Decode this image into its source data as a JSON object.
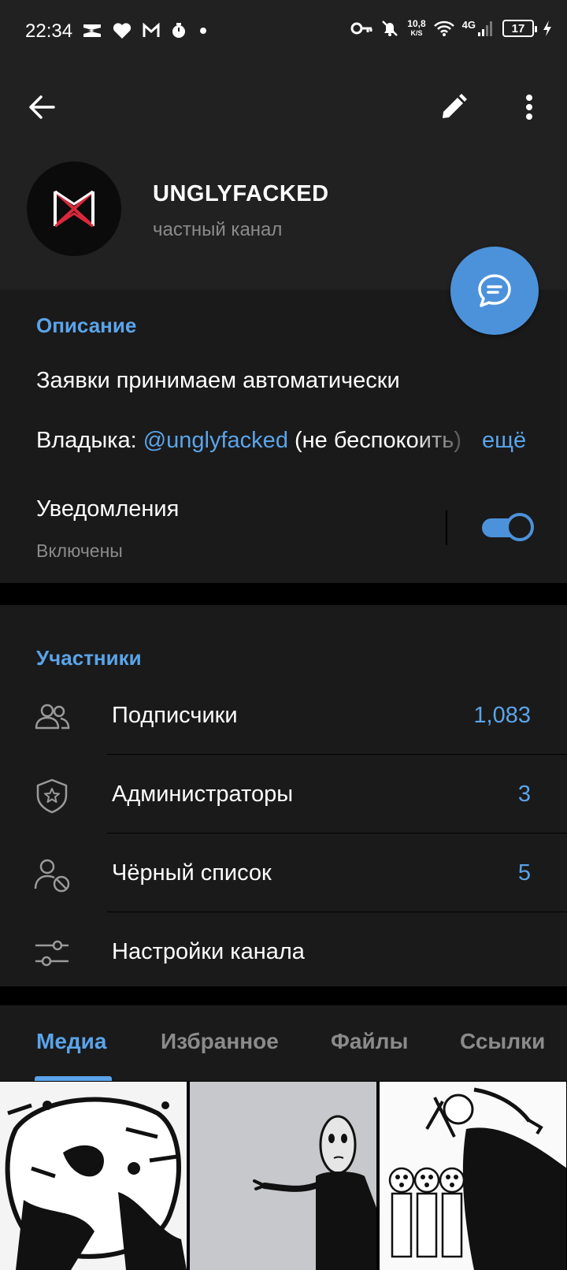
{
  "status": {
    "time": "22:34",
    "speed_value": "10,8",
    "speed_unit": "K/S",
    "network": "4G",
    "battery": "17"
  },
  "header": {
    "channel_name": "UNGLYFACKED",
    "channel_subtitle": "частный канал"
  },
  "info": {
    "description_title": "Описание",
    "description_line1": "Заявки принимаем автоматически",
    "owner_prefix": "Владыка: ",
    "owner_mention": "@unglyfacked",
    "owner_suffix": " (не беспокоить)",
    "more_label": "ещё",
    "notifications_label": "Уведомления",
    "notifications_value": "Включены",
    "notifications_enabled": true
  },
  "members": {
    "title": "Участники",
    "rows": [
      {
        "label": "Подписчики",
        "count": "1,083",
        "icon": "people-icon"
      },
      {
        "label": "Администраторы",
        "count": "3",
        "icon": "admin-shield-icon"
      },
      {
        "label": "Чёрный список",
        "count": "5",
        "icon": "blocked-user-icon"
      },
      {
        "label": "Настройки канала",
        "count": "",
        "icon": "settings-sliders-icon"
      }
    ]
  },
  "tabs": [
    {
      "label": "Медиа",
      "active": true
    },
    {
      "label": "Избранное",
      "active": false
    },
    {
      "label": "Файлы",
      "active": false
    },
    {
      "label": "Ссылки",
      "active": false
    }
  ],
  "colors": {
    "accent": "#5aa4ea",
    "fab": "#4c92db",
    "header_bg": "#212121",
    "card_bg": "#1a1a1a",
    "logo_red": "#d8293b"
  }
}
